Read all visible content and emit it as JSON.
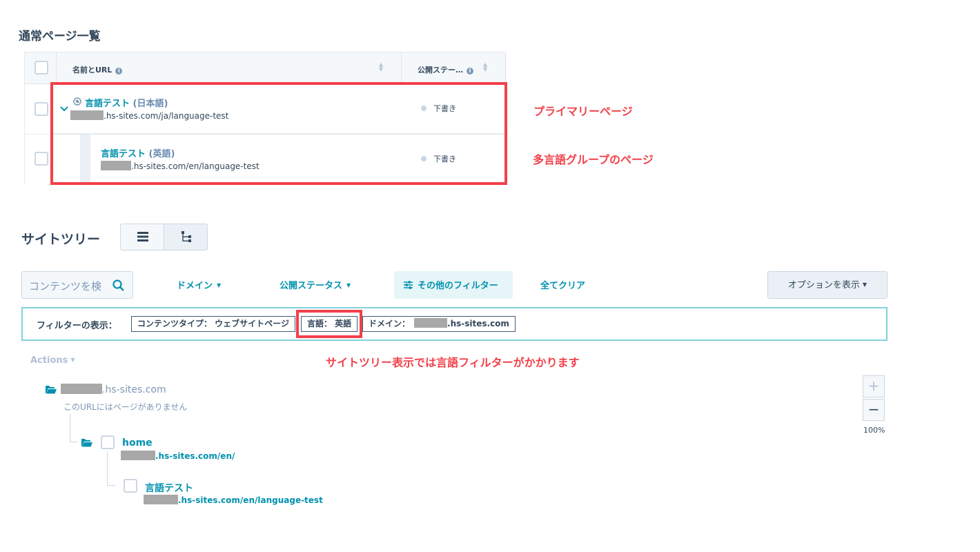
{
  "section1": {
    "title": "通常ページ一覧",
    "table": {
      "col_name": "名前とURL",
      "col_status": "公開ステー…",
      "rows": [
        {
          "name": "言語テスト",
          "lang": "(日本語)",
          "url_suffix": ".hs-sites.com/ja/language-test",
          "status": "下書き"
        },
        {
          "name": "言語テスト",
          "lang": "(英語)",
          "url_suffix": ".hs-sites.com/en/language-test",
          "status": "下書き"
        }
      ]
    },
    "annotations": {
      "primary": "プライマリーページ",
      "group": "多言語グループのページ"
    }
  },
  "section2": {
    "title": "サイトツリー",
    "search_placeholder": "コンテンツを検",
    "filters": {
      "domain": "ドメイン",
      "status": "公開ステータス",
      "other": "その他のフィルター",
      "clear": "全てクリア",
      "options": "オプションを表示"
    },
    "filter_bar": {
      "label": "フィルターの表示：",
      "chips": {
        "content_type": "コンテンツタイプ： ウェブサイトページ",
        "language": "言語： 英語",
        "domain_prefix": "ドメイン：",
        "domain_suffix": ".hs-sites.com"
      }
    },
    "annotation": "サイトツリー表示では言語フィルターがかかります",
    "actions": "Actions",
    "tree": {
      "root_suffix": ".hs-sites.com",
      "root_note": "このURLにはページがありません",
      "home_name": "home",
      "home_url_suffix": ".hs-sites.com/en/",
      "child_name": "言語テスト",
      "child_url_suffix": ".hs-sites.com/en/language-test"
    },
    "zoom": {
      "plus": "+",
      "minus": "−",
      "level": "100%"
    }
  },
  "colors": {
    "teal": "#0091ae",
    "annotation_red": "#f2404a",
    "text": "#33475b"
  }
}
